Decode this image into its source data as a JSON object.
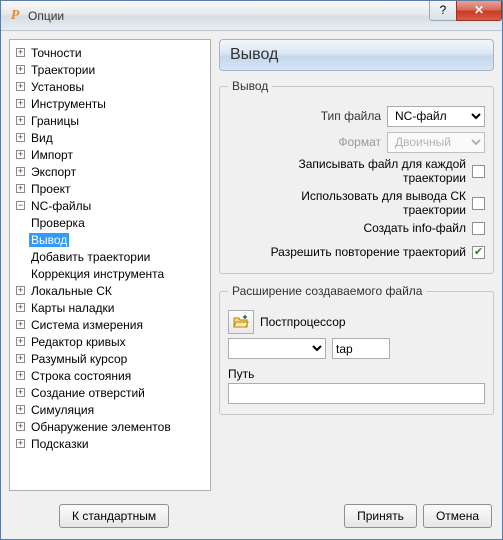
{
  "window": {
    "title": "Опции"
  },
  "tree": {
    "items": [
      {
        "label": "Точности",
        "exp": "+"
      },
      {
        "label": "Траектории",
        "exp": "+"
      },
      {
        "label": "Установы",
        "exp": "+"
      },
      {
        "label": "Инструменты",
        "exp": "+"
      },
      {
        "label": "Границы",
        "exp": "+"
      },
      {
        "label": "Вид",
        "exp": "+"
      },
      {
        "label": "Импорт",
        "exp": "+"
      },
      {
        "label": "Экспорт",
        "exp": "+"
      },
      {
        "label": "Проект",
        "exp": "+"
      },
      {
        "label": "NC-файлы",
        "exp": "−",
        "children": [
          {
            "label": "Проверка"
          },
          {
            "label": "Вывод",
            "selected": true
          },
          {
            "label": "Добавить траектории"
          },
          {
            "label": "Коррекция инструмента"
          }
        ]
      },
      {
        "label": "Локальные СК",
        "exp": "+"
      },
      {
        "label": "Карты наладки",
        "exp": "+"
      },
      {
        "label": "Система измерения",
        "exp": "+"
      },
      {
        "label": "Редактор кривых",
        "exp": "+"
      },
      {
        "label": "Разумный курсор",
        "exp": "+"
      },
      {
        "label": "Строка состояния",
        "exp": "+"
      },
      {
        "label": "Создание отверстий",
        "exp": "+"
      },
      {
        "label": "Симуляция",
        "exp": "+"
      },
      {
        "label": "Обнаружение элементов",
        "exp": "+"
      },
      {
        "label": "Подсказки",
        "exp": "+"
      }
    ]
  },
  "panel": {
    "title": "Вывод",
    "group": {
      "legend": "Вывод",
      "filetype_label": "Тип файла",
      "filetype_value": "NC-файл",
      "format_label": "Формат",
      "format_value": "Двоичный",
      "write_each_label": "Записывать файл для каждой траектории",
      "write_each_checked": false,
      "use_cs_label": "Использовать для вывода СК траектории",
      "use_cs_checked": false,
      "create_info_label": "Создать info-файл",
      "create_info_checked": false,
      "allow_repeat_label": "Разрешить повторение траекторий",
      "allow_repeat_checked": true
    },
    "ext_group": {
      "legend": "Расширение создаваемого файла",
      "postproc_label": "Постпроцессор",
      "combo_value": "",
      "ext_value": "tap",
      "path_label": "Путь",
      "path_value": ""
    }
  },
  "buttons": {
    "defaults": "К стандартным",
    "accept": "Принять",
    "cancel": "Отмена"
  }
}
